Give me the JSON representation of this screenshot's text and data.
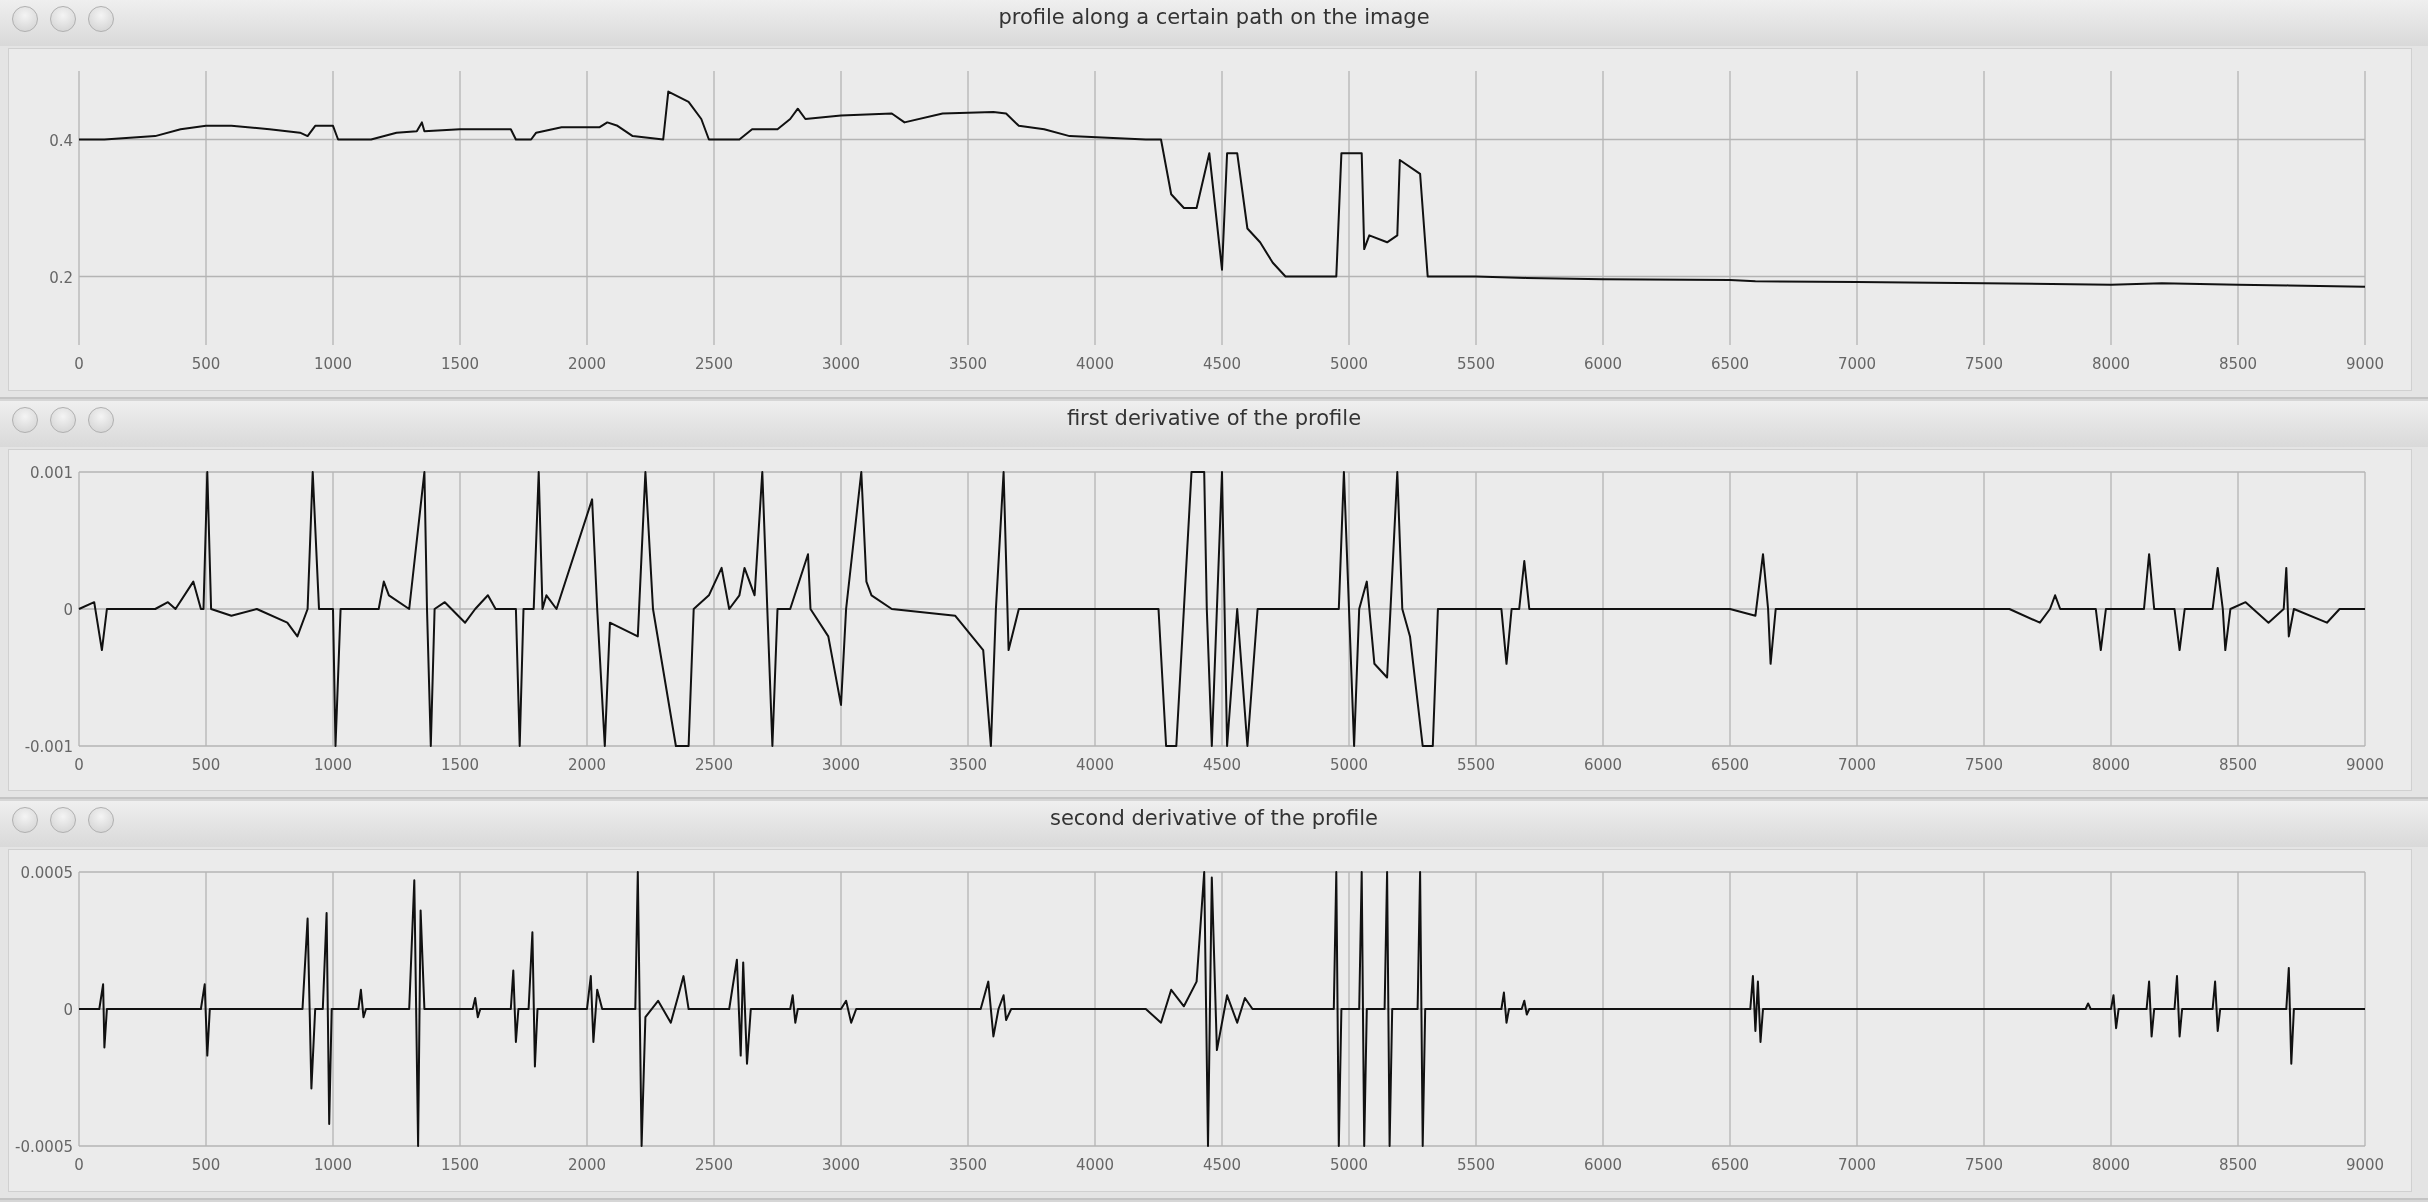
{
  "windows": [
    {
      "title": "profile along a certain path on the image",
      "chart_data": {
        "type": "line",
        "grid": true,
        "xlim": [
          0,
          9000
        ],
        "ylim": [
          0.1,
          0.5
        ],
        "xticks": [
          0,
          500,
          1000,
          1500,
          2000,
          2500,
          3000,
          3500,
          4000,
          4500,
          5000,
          5500,
          6000,
          6500,
          7000,
          7500,
          8000,
          8500,
          9000
        ],
        "yticks": [
          0.2,
          0.4
        ],
        "x": [
          0,
          100,
          300,
          400,
          500,
          600,
          750,
          870,
          900,
          930,
          1000,
          1020,
          1150,
          1250,
          1330,
          1350,
          1360,
          1500,
          1700,
          1720,
          1780,
          1800,
          1900,
          2050,
          2080,
          2120,
          2180,
          2300,
          2320,
          2400,
          2450,
          2480,
          2600,
          2650,
          2750,
          2800,
          2830,
          2860,
          3000,
          3200,
          3250,
          3400,
          3600,
          3650,
          3700,
          3800,
          3900,
          4200,
          4260,
          4300,
          4350,
          4400,
          4450,
          4500,
          4520,
          4560,
          4600,
          4650,
          4700,
          4750,
          4950,
          4970,
          5050,
          5060,
          5080,
          5150,
          5190,
          5200,
          5280,
          5310,
          5500,
          5700,
          6000,
          6500,
          6600,
          7000,
          7500,
          8000,
          8200,
          8500,
          8700,
          9000
        ],
        "series": [
          {
            "values": [
              0.4,
              0.4,
              0.405,
              0.415,
              0.42,
              0.42,
              0.415,
              0.41,
              0.405,
              0.42,
              0.42,
              0.4,
              0.4,
              0.41,
              0.412,
              0.425,
              0.412,
              0.415,
              0.415,
              0.4,
              0.4,
              0.41,
              0.418,
              0.418,
              0.425,
              0.42,
              0.405,
              0.4,
              0.47,
              0.455,
              0.43,
              0.4,
              0.4,
              0.415,
              0.415,
              0.43,
              0.445,
              0.43,
              0.435,
              0.438,
              0.425,
              0.438,
              0.44,
              0.438,
              0.42,
              0.415,
              0.405,
              0.4,
              0.4,
              0.32,
              0.3,
              0.3,
              0.38,
              0.21,
              0.38,
              0.38,
              0.27,
              0.25,
              0.22,
              0.2,
              0.2,
              0.38,
              0.38,
              0.24,
              0.26,
              0.25,
              0.26,
              0.37,
              0.35,
              0.2,
              0.2,
              0.198,
              0.196,
              0.195,
              0.193,
              0.192,
              0.19,
              0.188,
              0.19,
              0.188,
              0.187,
              0.185
            ]
          }
        ]
      }
    },
    {
      "title": "first derivative of the profile",
      "chart_data": {
        "type": "line",
        "grid": true,
        "xlim": [
          0,
          9000
        ],
        "ylim": [
          -0.001,
          0.001
        ],
        "xticks": [
          0,
          500,
          1000,
          1500,
          2000,
          2500,
          3000,
          3500,
          4000,
          4500,
          5000,
          5500,
          6000,
          6500,
          7000,
          7500,
          8000,
          8500,
          9000
        ],
        "yticks": [
          -0.001,
          0,
          0.001
        ],
        "x": [
          0,
          60,
          90,
          110,
          300,
          350,
          380,
          450,
          480,
          490,
          505,
          520,
          600,
          700,
          820,
          860,
          900,
          920,
          945,
          1000,
          1010,
          1030,
          1180,
          1200,
          1220,
          1300,
          1360,
          1370,
          1385,
          1400,
          1440,
          1520,
          1560,
          1610,
          1640,
          1720,
          1735,
          1750,
          1790,
          1810,
          1825,
          1840,
          1880,
          2020,
          2040,
          2070,
          2090,
          2200,
          2230,
          2260,
          2350,
          2400,
          2420,
          2480,
          2530,
          2560,
          2600,
          2620,
          2660,
          2690,
          2710,
          2730,
          2750,
          2800,
          2870,
          2880,
          2950,
          3000,
          3020,
          3080,
          3100,
          3120,
          3200,
          3450,
          3560,
          3590,
          3610,
          3640,
          3660,
          3700,
          4250,
          4280,
          4320,
          4350,
          4380,
          4430,
          4440,
          4460,
          4480,
          4500,
          4520,
          4560,
          4600,
          4640,
          4700,
          4960,
          4980,
          5000,
          5020,
          5040,
          5070,
          5100,
          5150,
          5190,
          5210,
          5240,
          5290,
          5330,
          5350,
          5600,
          5620,
          5640,
          5670,
          5690,
          5710,
          6500,
          6600,
          6630,
          6650,
          6660,
          6680,
          7600,
          7720,
          7760,
          7780,
          7800,
          7940,
          7960,
          7980,
          8130,
          8150,
          8170,
          8250,
          8270,
          8290,
          8400,
          8420,
          8440,
          8450,
          8470,
          8530,
          8620,
          8680,
          8690,
          8700,
          8720,
          8850,
          8900,
          9000
        ],
        "series": [
          {
            "values": [
              0,
              5e-05,
              -0.0003,
              0,
              0,
              5e-05,
              0,
              0.0002,
              0,
              0,
              0.001,
              0,
              -5e-05,
              0,
              -0.0001,
              -0.0002,
              0,
              0.001,
              0,
              0,
              -0.001,
              0,
              0,
              0.0002,
              0.0001,
              0,
              0.001,
              0,
              -0.001,
              0,
              5e-05,
              -0.0001,
              0,
              0.0001,
              0,
              0,
              -0.001,
              0,
              0,
              0.001,
              0,
              0.0001,
              0,
              0.0008,
              0,
              -0.001,
              -0.0001,
              -0.0002,
              0.001,
              0,
              -0.001,
              -0.001,
              0,
              0.0001,
              0.0003,
              0,
              0.0001,
              0.0003,
              0.0001,
              0.001,
              0,
              -0.001,
              0,
              0,
              0.0004,
              0,
              -0.0002,
              -0.0007,
              0,
              0.001,
              0.0002,
              0.0001,
              0,
              -5e-05,
              -0.0003,
              -0.001,
              0,
              0.001,
              -0.0003,
              0,
              0,
              -0.001,
              -0.001,
              0,
              0.001,
              0.001,
              0,
              -0.001,
              0,
              0.001,
              -0.001,
              0,
              -0.001,
              0,
              0,
              0,
              0.001,
              0,
              -0.001,
              0,
              0.0002,
              -0.0004,
              -0.0005,
              0.001,
              0,
              -0.0002,
              -0.001,
              -0.001,
              0,
              0,
              -0.0004,
              0,
              0,
              0.00035,
              0,
              0,
              -5e-05,
              0.0004,
              0,
              -0.0004,
              0,
              0,
              -0.0001,
              0,
              0.0001,
              0,
              0,
              -0.0003,
              0,
              0,
              0.0004,
              0,
              0,
              -0.0003,
              0,
              0,
              0.0003,
              0,
              -0.0003,
              0,
              5e-05,
              -0.0001,
              0,
              0.0003,
              -0.0002,
              0,
              -0.0001,
              0,
              0
            ]
          }
        ]
      }
    },
    {
      "title": "second derivative of the profile",
      "chart_data": {
        "type": "line",
        "grid": true,
        "xlim": [
          0,
          9000
        ],
        "ylim": [
          -0.0005,
          0.0005
        ],
        "xticks": [
          0,
          500,
          1000,
          1500,
          2000,
          2500,
          3000,
          3500,
          4000,
          4500,
          5000,
          5500,
          6000,
          6500,
          7000,
          7500,
          8000,
          8500,
          9000
        ],
        "yticks": [
          -0.0005,
          0,
          0.0005
        ],
        "x": [
          0,
          80,
          95,
          100,
          110,
          480,
          495,
          505,
          515,
          880,
          900,
          915,
          930,
          960,
          975,
          985,
          995,
          1100,
          1110,
          1120,
          1130,
          1300,
          1320,
          1335,
          1345,
          1360,
          1550,
          1560,
          1570,
          1580,
          1700,
          1710,
          1720,
          1730,
          1770,
          1785,
          1795,
          1805,
          2000,
          2015,
          2025,
          2040,
          2060,
          2190,
          2200,
          2215,
          2230,
          2280,
          2330,
          2360,
          2380,
          2400,
          2560,
          2590,
          2605,
          2615,
          2630,
          2645,
          2800,
          2810,
          2820,
          2830,
          3000,
          3020,
          3040,
          3060,
          3550,
          3580,
          3600,
          3620,
          3640,
          3650,
          3670,
          4200,
          4260,
          4300,
          4350,
          4400,
          4430,
          4445,
          4460,
          4480,
          4520,
          4560,
          4590,
          4620,
          4940,
          4950,
          4960,
          4970,
          5040,
          5050,
          5060,
          5070,
          5140,
          5150,
          5160,
          5170,
          5270,
          5280,
          5290,
          5300,
          5600,
          5610,
          5620,
          5630,
          5680,
          5690,
          5700,
          5710,
          6580,
          6590,
          6600,
          6610,
          6620,
          6630,
          7900,
          7910,
          7920,
          8000,
          8010,
          8020,
          8030,
          8140,
          8150,
          8160,
          8170,
          8250,
          8260,
          8270,
          8280,
          8400,
          8410,
          8420,
          8430,
          8690,
          8700,
          8710,
          8720,
          9000
        ],
        "series": [
          {
            "values": [
              0,
              0,
              9e-05,
              -0.00014,
              0,
              0,
              9e-05,
              -0.00017,
              0,
              0,
              0.00033,
              -0.00029,
              0,
              0,
              0.00035,
              -0.00042,
              0,
              0,
              7e-05,
              -3e-05,
              0,
              0,
              0.00047,
              -0.0005,
              0.00036,
              0,
              0,
              4e-05,
              -3e-05,
              0,
              0,
              0.00014,
              -0.00012,
              0,
              0,
              0.00028,
              -0.00021,
              0,
              0,
              0.00012,
              -0.00012,
              7e-05,
              0,
              0,
              0.0005,
              -0.0005,
              -3e-05,
              3e-05,
              -5e-05,
              5e-05,
              0.00012,
              0,
              0,
              0.00018,
              -0.00017,
              0.00017,
              -0.0002,
              0,
              0,
              5e-05,
              -5e-05,
              0,
              0,
              3e-05,
              -5e-05,
              0,
              0,
              0.0001,
              -0.0001,
              0,
              5e-05,
              -4e-05,
              0,
              0,
              -5e-05,
              7e-05,
              1e-05,
              0.0001,
              0.0005,
              -0.0005,
              0.00048,
              -0.00015,
              5e-05,
              -5e-05,
              4e-05,
              0,
              0,
              0.0005,
              -0.0005,
              0,
              0,
              0.0005,
              -0.0005,
              0,
              0,
              0.0005,
              -0.0005,
              0,
              0,
              0.0005,
              -0.0005,
              0,
              0,
              6e-05,
              -5e-05,
              0,
              0,
              3e-05,
              -2e-05,
              0,
              0,
              0.00012,
              -8e-05,
              0.0001,
              -0.00012,
              0,
              0,
              2e-05,
              0,
              0,
              5e-05,
              -7e-05,
              0,
              0,
              0.0001,
              -0.0001,
              0,
              0,
              0.00012,
              -0.0001,
              0,
              0,
              0.0001,
              -8e-05,
              0,
              0,
              0.00015,
              -0.0002,
              0,
              0
            ]
          }
        ]
      }
    }
  ]
}
